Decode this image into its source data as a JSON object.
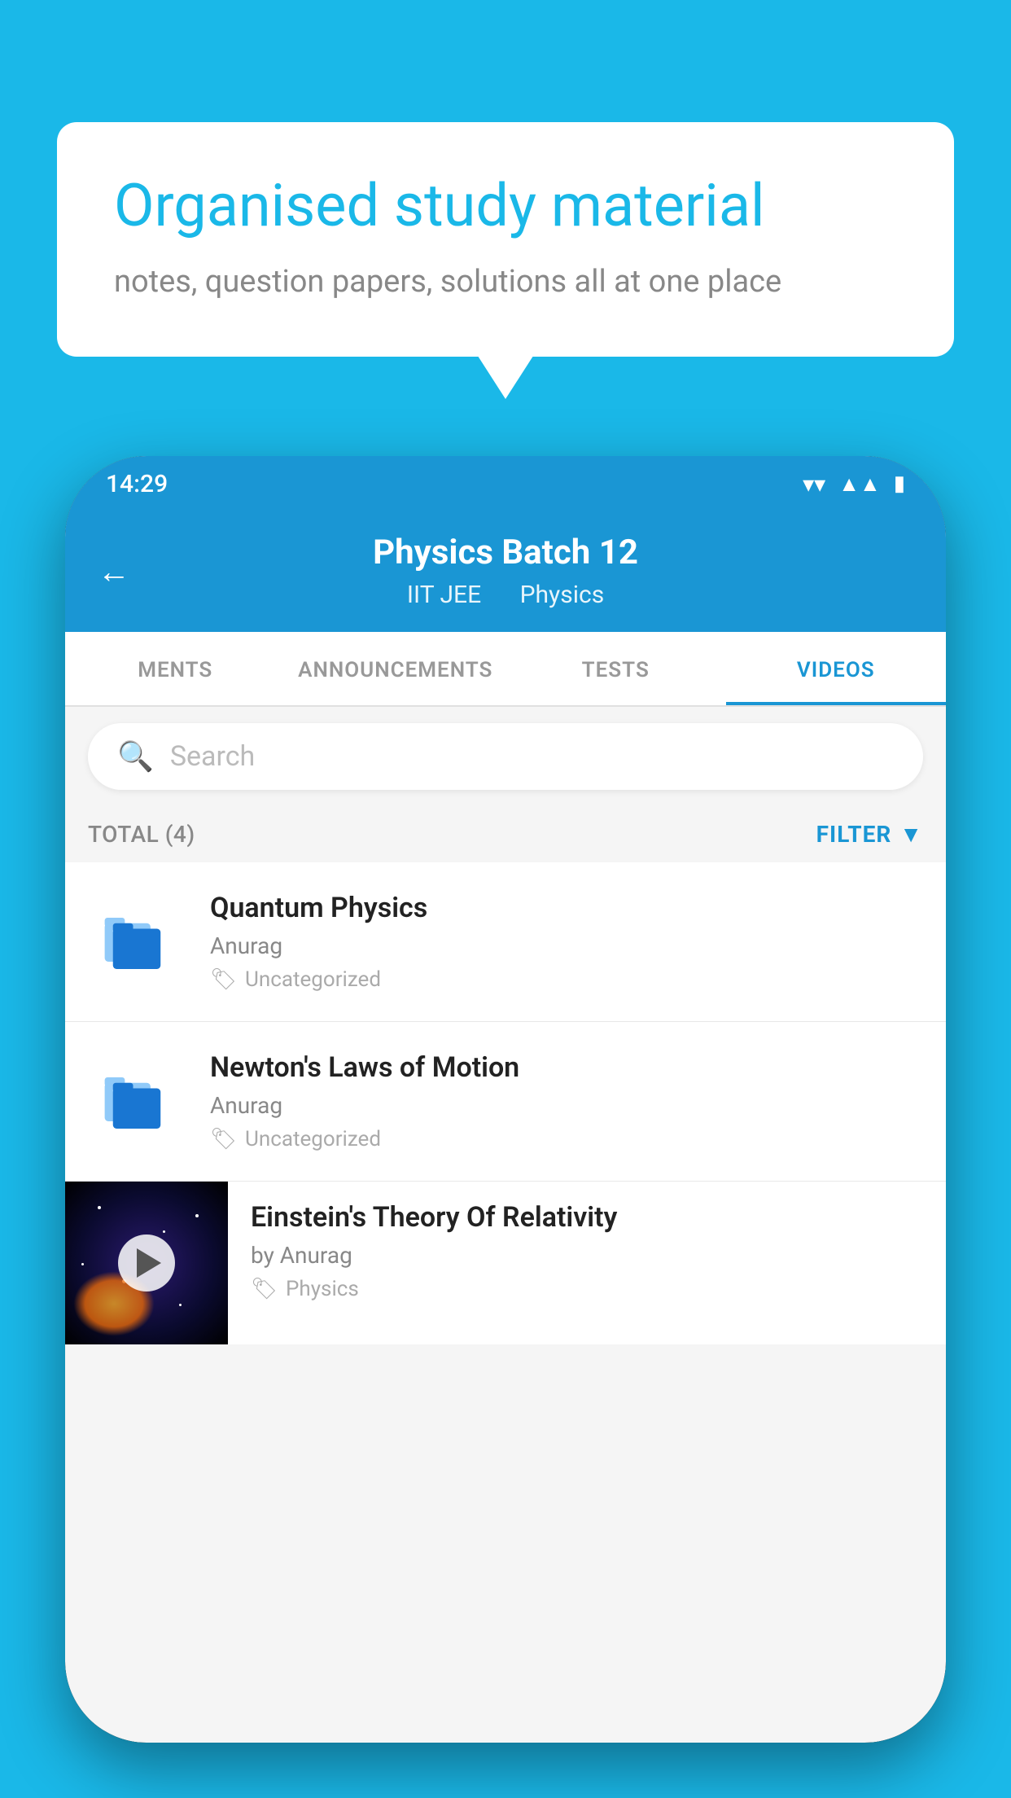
{
  "background_color": "#1ab8e8",
  "speech_bubble": {
    "title": "Organised study material",
    "subtitle": "notes, question papers, solutions all at one place"
  },
  "phone": {
    "status_bar": {
      "time": "14:29"
    },
    "header": {
      "title": "Physics Batch 12",
      "subtitle_part1": "IIT JEE",
      "subtitle_part2": "Physics",
      "back_label": "←"
    },
    "tabs": [
      {
        "label": "MENTS",
        "active": false
      },
      {
        "label": "ANNOUNCEMENTS",
        "active": false
      },
      {
        "label": "TESTS",
        "active": false
      },
      {
        "label": "VIDEOS",
        "active": true
      }
    ],
    "search": {
      "placeholder": "Search"
    },
    "filter_bar": {
      "total_label": "TOTAL (4)",
      "filter_label": "FILTER"
    },
    "videos": [
      {
        "id": 1,
        "title": "Quantum Physics",
        "author": "Anurag",
        "tag": "Uncategorized",
        "type": "file"
      },
      {
        "id": 2,
        "title": "Newton's Laws of Motion",
        "author": "Anurag",
        "tag": "Uncategorized",
        "type": "file"
      },
      {
        "id": 3,
        "title": "Einstein's Theory Of Relativity",
        "author": "by Anurag",
        "tag": "Physics",
        "type": "thumbnail"
      }
    ]
  }
}
